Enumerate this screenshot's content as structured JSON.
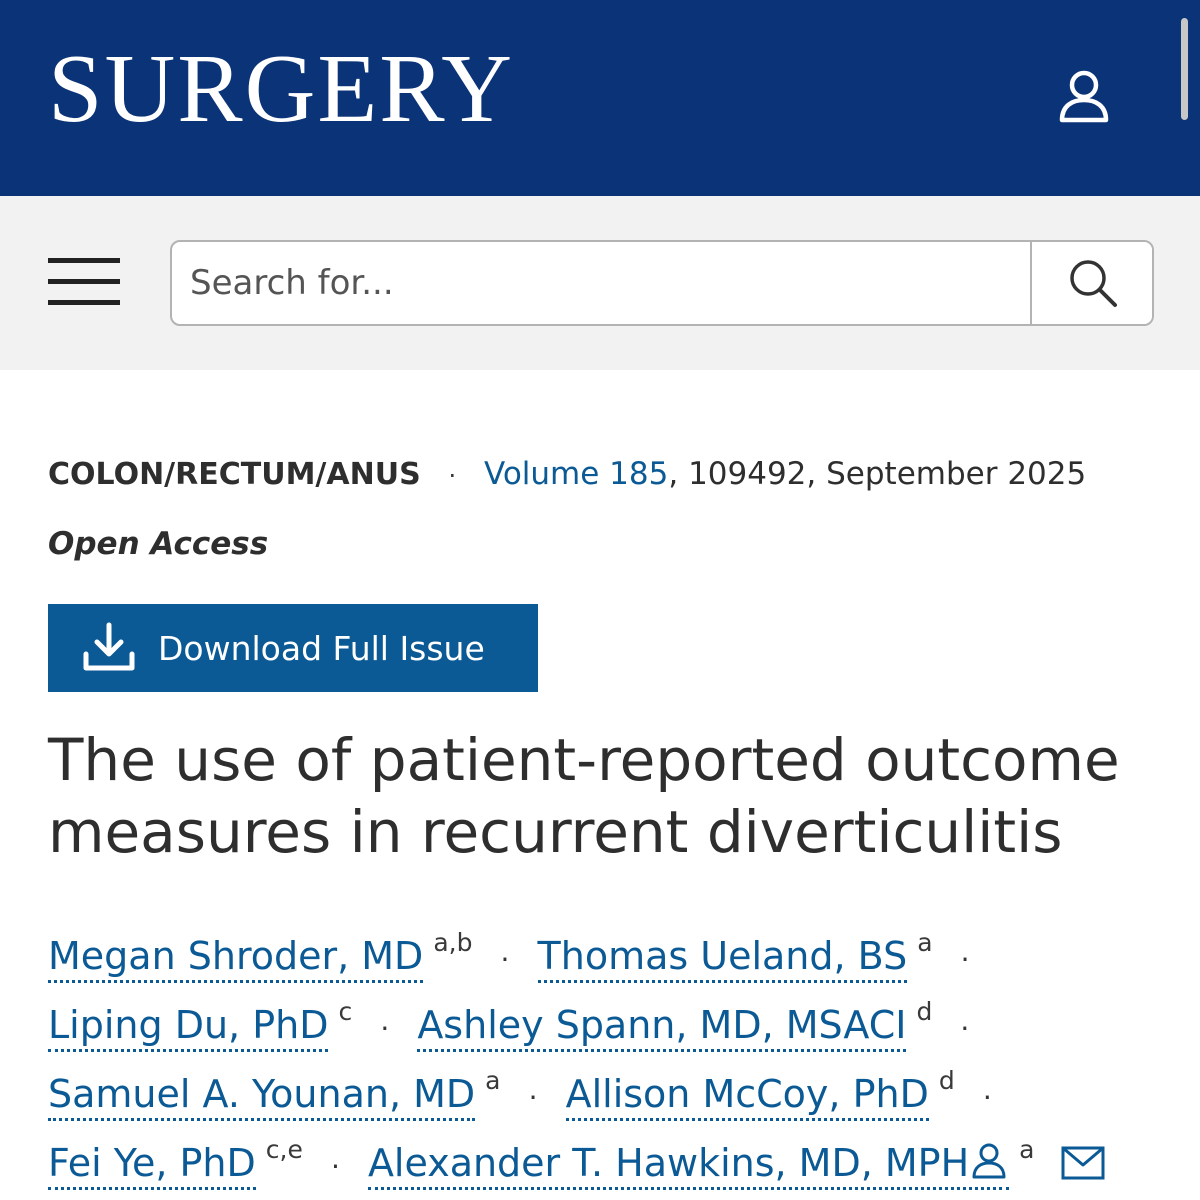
{
  "header": {
    "logo_text": "SURGERY",
    "user_icon": "user-icon",
    "background_color": "#0b3377"
  },
  "search": {
    "placeholder": "Search for...",
    "menu_icon": "hamburger-menu-icon",
    "search_icon": "search-icon"
  },
  "article": {
    "section": "COLON/RECTUM/ANUS",
    "separator": "·",
    "volume": "Volume 185",
    "citation_rest": ", 109492, September 2025",
    "access": "Open Access",
    "download_label": "Download Full Issue",
    "download_icon": "download-icon",
    "title": "The use of patient-reported outcome measures in recurrent diverticulitis",
    "accent_color": "#0b5a95"
  },
  "authors": [
    {
      "name": "Megan Shroder, MD",
      "aff": "a,b"
    },
    {
      "name": "Thomas Ueland, BS",
      "aff": "a"
    },
    {
      "name": "Liping Du, PhD",
      "aff": "c"
    },
    {
      "name": "Ashley Spann, MD, MSACI",
      "aff": "d"
    },
    {
      "name": "Samuel A. Younan, MD",
      "aff": "a"
    },
    {
      "name": "Allison McCoy, PhD",
      "aff": "d"
    },
    {
      "name": "Fei Ye, PhD",
      "aff": "c,e"
    },
    {
      "name": "Alexander T. Hawkins, MD, MPH",
      "aff": "a",
      "icons": [
        "person-icon",
        "mail-icon"
      ]
    }
  ],
  "author_separator": "·"
}
